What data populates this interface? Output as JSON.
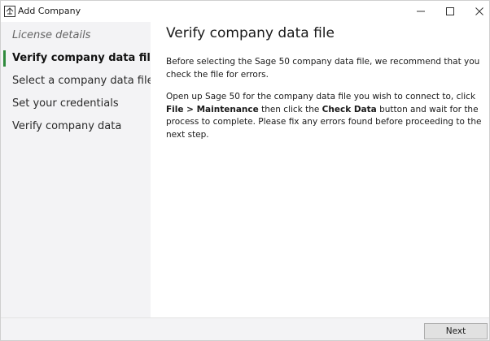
{
  "window": {
    "title": "Add Company",
    "icon": "add-company-app-icon"
  },
  "sidebar": {
    "steps": [
      {
        "label": "License details",
        "state": "done"
      },
      {
        "label": "Verify company data file",
        "state": "active"
      },
      {
        "label": "Select a company data file",
        "state": "pending"
      },
      {
        "label": "Set your credentials",
        "state": "pending"
      },
      {
        "label": "Verify company data",
        "state": "pending"
      }
    ],
    "active_color": "#2f8a3c"
  },
  "main": {
    "heading": "Verify company data file",
    "paragraph1": "Before selecting the Sage 50 company data file, we recommend that you check the file for errors.",
    "paragraph2": {
      "t1": "Open up Sage 50 for the company data file you wish to connect to, click ",
      "b1": "File > Maintenance",
      "t2": " then click the ",
      "b2": "Check Data",
      "t3": " button and wait for the process to complete. Please fix any errors found before proceeding to the next step."
    }
  },
  "footer": {
    "next_label": "Next"
  }
}
